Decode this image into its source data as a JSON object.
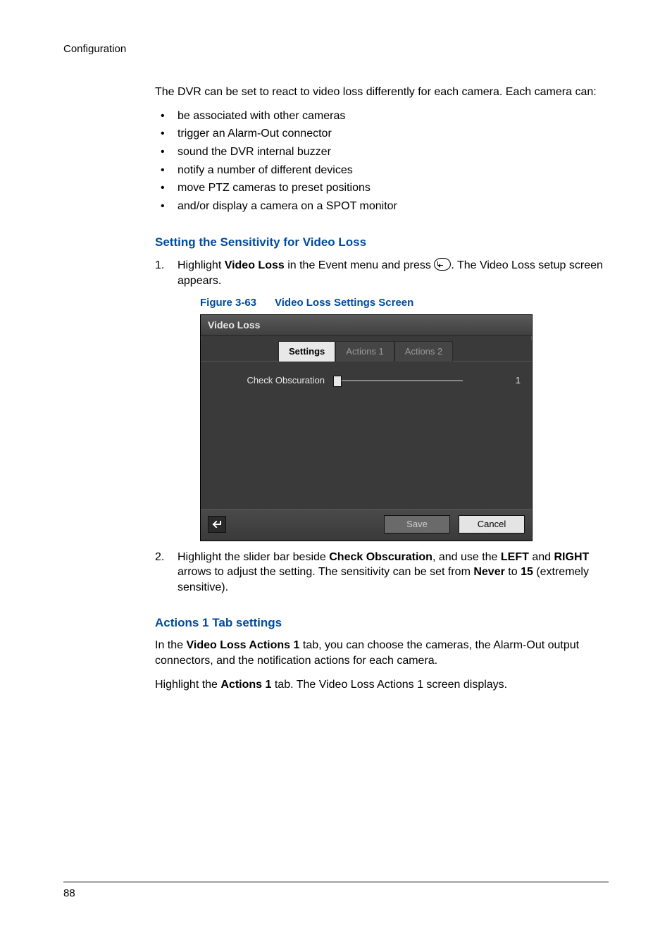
{
  "running_head": "Configuration",
  "intro_para": "The DVR can be set to react to video loss differently for each camera. Each camera can:",
  "bullets": [
    "be associated with other cameras",
    "trigger an Alarm-Out connector",
    "sound the DVR internal buzzer",
    "notify a number of different devices",
    "move PTZ cameras to preset positions",
    "and/or display a camera on a SPOT monitor"
  ],
  "section1": {
    "heading": "Setting the Sensitivity for Video Loss",
    "step1_pre": "Highlight ",
    "step1_bold": "Video Loss",
    "step1_mid": " in the Event menu and press ",
    "step1_post": ". The Video Loss setup screen appears.",
    "figure_num": "Figure 3-63",
    "figure_title": "Video Loss Settings Screen",
    "step2_pre": "Highlight the slider bar beside ",
    "step2_b1": "Check Obscuration",
    "step2_mid1": ", and use the ",
    "step2_b2": "LEFT",
    "step2_mid2": " and ",
    "step2_b3": "RIGHT",
    "step2_mid3": " arrows to adjust the setting. The sensitivity can be set from ",
    "step2_b4": "Never",
    "step2_mid4": " to ",
    "step2_b5": "15",
    "step2_post": " (extremely sensitive)."
  },
  "dialog": {
    "title": "Video Loss",
    "tabs": {
      "settings": "Settings",
      "actions1": "Actions 1",
      "actions2": "Actions 2"
    },
    "row_label": "Check Obscuration",
    "slider_value": "1",
    "save": "Save",
    "cancel": "Cancel"
  },
  "section2": {
    "heading": "Actions 1 Tab settings",
    "p1_pre": "In the ",
    "p1_bold": "Video Loss Actions 1",
    "p1_post": " tab, you can choose the cameras, the Alarm-Out output connectors, and the notification actions for each camera.",
    "p2_pre": "Highlight the ",
    "p2_bold": "Actions 1",
    "p2_post": " tab. The Video Loss Actions 1 screen displays."
  },
  "page_number": "88"
}
